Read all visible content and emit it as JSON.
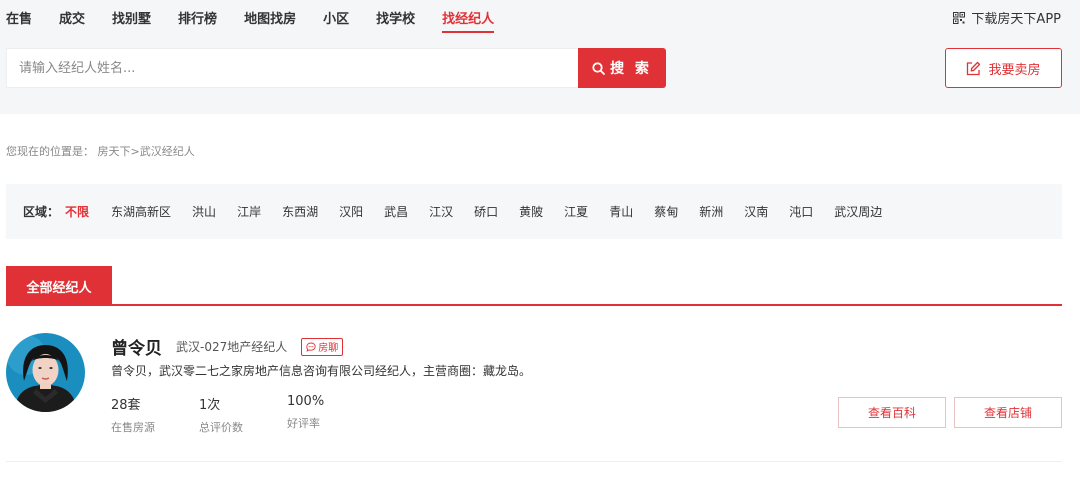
{
  "nav": {
    "items": [
      "在售",
      "成交",
      "找别墅",
      "排行榜",
      "地图找房",
      "小区",
      "找学校",
      "找经纪人"
    ],
    "active_index": 7,
    "app_link": "下载房天下APP"
  },
  "search": {
    "placeholder": "请输入经纪人姓名...",
    "button_label": "搜 索"
  },
  "sell_button": "我要卖房",
  "breadcrumb": "您现在的位置是： 房天下>武汉经纪人",
  "filter": {
    "label": "区域：",
    "options": [
      "不限",
      "东湖高新区",
      "洪山",
      "江岸",
      "东西湖",
      "汉阳",
      "武昌",
      "江汉",
      "硚口",
      "黄陂",
      "江夏",
      "青山",
      "蔡甸",
      "新洲",
      "汉南",
      "沌口",
      "武汉周边"
    ],
    "active_index": 0
  },
  "tab": {
    "label": "全部经纪人"
  },
  "agent": {
    "name": "曾令贝",
    "company": "武汉-027地产经纪人",
    "chat_badge": "房聊",
    "description": "曾令贝，武汉零二七之家房地产信息咨询有限公司经纪人，主营商圈：藏龙岛。",
    "stats": [
      {
        "value": "28套",
        "label": "在售房源"
      },
      {
        "value": "1次",
        "label": "总评价数"
      },
      {
        "value": "100%",
        "label": "好评率"
      }
    ],
    "buttons": {
      "baike": "查看百科",
      "store": "查看店铺"
    }
  },
  "colors": {
    "accent": "#e03236",
    "band": "#f5f6f8"
  }
}
